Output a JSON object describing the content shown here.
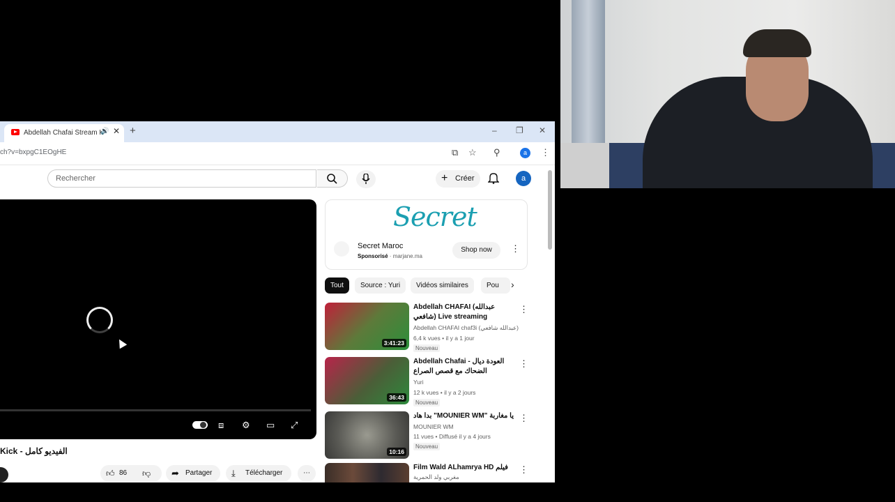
{
  "browser": {
    "tab_title": "Abdellah Chafai Stream Kick",
    "url": "ch?v=bxpgC1EOgHE",
    "profile_initial": "a"
  },
  "youtube": {
    "search_placeholder": "Rechercher",
    "create_label": "Créer",
    "avatar_initial": "a",
    "video": {
      "title": "Kick - الفيديو كامل",
      "likes": "86",
      "share_label": "Partager",
      "download_label": "Télécharger"
    },
    "ad": {
      "logo": "Secret",
      "advertiser": "Secret Maroc",
      "sponsored": "Sponsorisé",
      "domain": "marjane.ma",
      "cta": "Shop now"
    },
    "chips": [
      "Tout",
      "Source : Yuri",
      "Vidéos similaires",
      "Pou"
    ],
    "recommendations": [
      {
        "title": "Abdellah CHAFAI (عبدالله شافعي) Live streaming",
        "channel": "Abdellah CHAFAI chaf3i (عبدالله شافعي)",
        "meta": "6,4 k vues • il y a 1 jour",
        "badge": "Nouveau",
        "duration": "3:41:23"
      },
      {
        "title": "Abdellah Chafai - العودة ديال الضحاك مع قصص الصراع",
        "channel": "Yuri",
        "meta": "12 k vues • il y a 2 jours",
        "badge": "Nouveau",
        "duration": "36:43"
      },
      {
        "title": "بدا هاد \"MOUNIER WM\" يا مغاربة",
        "channel": "MOUNIER WM",
        "meta": "11 vues • Diffusé il y a 4 jours",
        "badge": "Nouveau",
        "duration": "10:16"
      },
      {
        "title": "Film Wald ALhamrya HD فيلم",
        "channel": "مغربي ولد الحمرية",
        "meta": "",
        "badge": "",
        "duration": ""
      }
    ]
  }
}
